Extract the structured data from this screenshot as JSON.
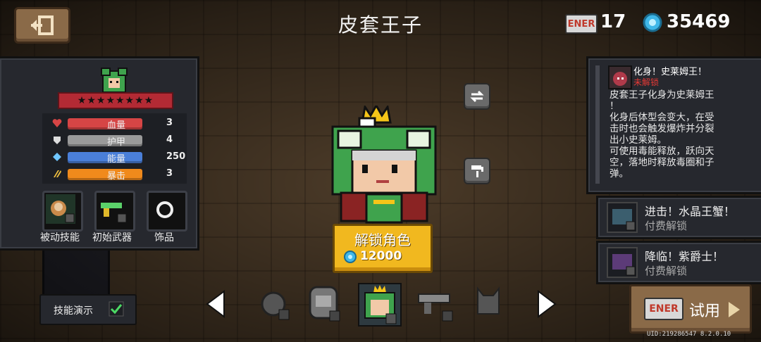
{
  "header": {
    "title": "皮套王子",
    "ticket_badge": "ENER",
    "ticket_count": "17",
    "gem_count": "35469"
  },
  "character_panel": {
    "stars": "★★★★★★★★",
    "stats": [
      {
        "icon": "heart-icon",
        "label": "血量",
        "value": "3",
        "color": "#d64545"
      },
      {
        "icon": "shield-icon",
        "label": "护甲",
        "value": "4",
        "color": "#9a9a9a"
      },
      {
        "icon": "energy-icon",
        "label": "能量",
        "value": "250",
        "color": "#4a7fd9"
      },
      {
        "icon": "crit-icon",
        "label": "暴击",
        "value": "3",
        "color": "#f08a1c"
      }
    ],
    "slots": [
      {
        "label": "被动技能",
        "locked": true
      },
      {
        "label": "初始武器",
        "locked": true
      },
      {
        "label": "饰品",
        "locked": false
      }
    ]
  },
  "unlock": {
    "title": "解锁角色",
    "price": "12000"
  },
  "skill": {
    "name": "化身！史莱姆王！",
    "status": "未解锁",
    "description": "皮套王子化身为史莱姆王\n！\n化身后体型会变大，在受\n击时也会触发爆炸并分裂\n出小史莱姆。\n可使用毒能释放，跃向天\n空，落地时释放毒圈和子\n弹。"
  },
  "paid_skills": [
    {
      "title": "进击！水晶王蟹！",
      "subtitle": "付费解锁"
    },
    {
      "title": "降临！紫爵士！",
      "subtitle": "付费解锁"
    }
  ],
  "bottom": {
    "demo_label": "技能演示",
    "demo_checked": true,
    "try_badge": "ENER",
    "try_label": "试用",
    "uid": "UID:219286547 8.2.0.10"
  }
}
